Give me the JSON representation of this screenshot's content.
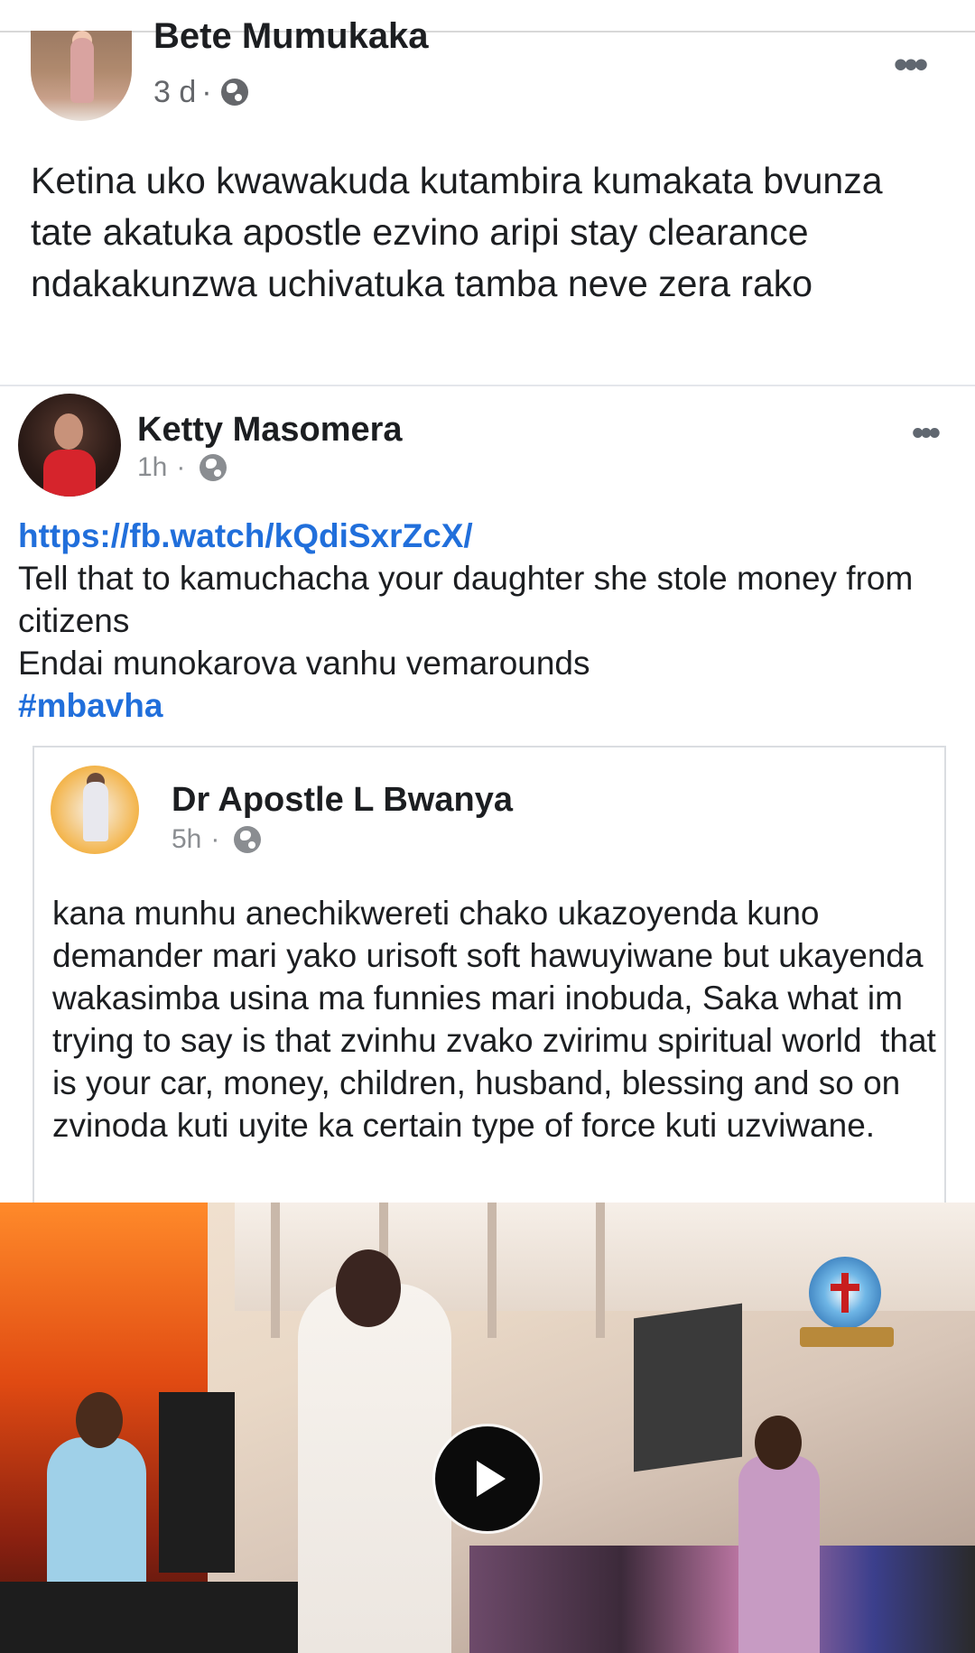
{
  "outer_post": {
    "author": "Bete Mumukaka",
    "time": "3 d",
    "separator": "·",
    "privacy_icon": "globe-icon",
    "more_icon": "more-options-icon",
    "more_label": "•••",
    "text": "Ketina uko kwawakuda kutambira kumakata bvunza tate akatuka apostle ezvino aripi stay clearance ndakakunzwa uchivatuka tamba neve zera rako"
  },
  "shared_post": {
    "author": "Ketty Masomera",
    "time": "1h",
    "separator": "·",
    "privacy_icon": "globe-icon",
    "more_label": "•••",
    "link": "https://fb.watch/kQdiSxrZcX/",
    "lines": [
      "Tell that to kamuchacha your daughter she stole money from citizens",
      "Endai munokarova vanhu vemarounds"
    ],
    "hashtag": "#mbavha"
  },
  "embedded_post": {
    "author": "Dr Apostle L Bwanya",
    "time": "5h",
    "separator": "·",
    "privacy_icon": "globe-icon",
    "text": "kana munhu anechikwereti chako ukazoyenda kuno demander mari yako urisoft soft hawuyiwane but ukayenda wakasimba usina ma funnies mari inobuda, Saka what im trying to say is that zvinhu zvako zvirimu spiritual world  that is your car, money, children, husband, blessing and so on zvinoda kuti uyite ka certain type of force kuti uzviwane."
  },
  "video": {
    "play_icon": "play-icon",
    "logo_icon": "church-logo-icon"
  },
  "colors": {
    "link": "#216fdb",
    "text": "#1c1e21",
    "meta": "#8a8d91"
  }
}
